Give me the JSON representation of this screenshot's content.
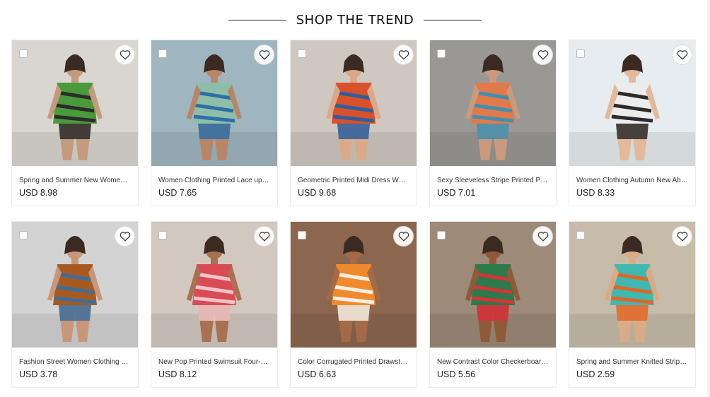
{
  "section_title": "SHOP THE TREND",
  "products": [
    {
      "title": "Spring and Summer New Women r...",
      "price": "USD 8.98",
      "bg": "#d9d6d2",
      "body": "#4a9a3c",
      "accent": "#2b2b2b",
      "skin": "#c49a7e"
    },
    {
      "title": "Women Clothing Printed Lace up S...",
      "price": "USD 7.65",
      "bg": "#9fb6c0",
      "body": "#8dbfa8",
      "accent": "#2f6fa8",
      "skin": "#b98568"
    },
    {
      "title": "Geometric Printed Midi Dress Wom...",
      "price": "USD 9.68",
      "bg": "#cfc8c0",
      "body": "#d8512a",
      "accent": "#2d5fa0",
      "skin": "#d9a98a"
    },
    {
      "title": "Sexy Sleeveless Stripe Printed Party...",
      "price": "USD 7.01",
      "bg": "#9a9894",
      "body": "#e07a4c",
      "accent": "#3f8fb0",
      "skin": "#c99a7d"
    },
    {
      "title": "Women Clothing Autumn New Abs...",
      "price": "USD 8.33",
      "bg": "#e6ecef",
      "body": "#ececec",
      "accent": "#2b2b2b",
      "skin": "#e2b99a"
    },
    {
      "title": "Fashion Street Women Clothing Str...",
      "price": "USD 3.78",
      "bg": "#d3d3d3",
      "body": "#a65a22",
      "accent": "#3f6d9a",
      "skin": "#c8977a"
    },
    {
      "title": "New Pop Printed Swimsuit Four-Pie...",
      "price": "USD 8.12",
      "bg": "#d2c8c0",
      "body": "#d94b55",
      "accent": "#f0c4c8",
      "skin": "#a97052"
    },
    {
      "title": "Color Corrugated Printed Drawstrin...",
      "price": "USD 6.63",
      "bg": "#8d6650",
      "body": "#f08a2e",
      "accent": "#f4efe4",
      "skin": "#a46a45"
    },
    {
      "title": "New Contrast Color Checkerboard ...",
      "price": "USD 5.56",
      "bg": "#9d8a78",
      "body": "#2d7a4a",
      "accent": "#d6333a",
      "skin": "#8e5a3a"
    },
    {
      "title": "Spring and Summer Knitted Stripe...",
      "price": "USD 2.59",
      "bg": "#c7bcaa",
      "body": "#3fb8b0",
      "accent": "#e0662a",
      "skin": "#d9ab87"
    }
  ]
}
